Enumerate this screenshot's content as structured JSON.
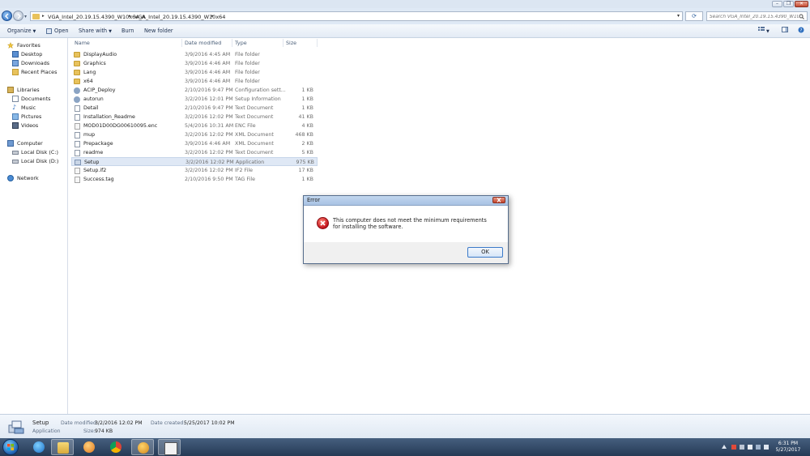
{
  "address": {
    "crumbs": [
      "VGA_Intel_20.19.15.4390_W10x64_A",
      "VGA_Intel_20.19.15.4390_W10x64"
    ],
    "search_placeholder": "Search VGA_Intel_20.19.15.4390_W10x64"
  },
  "toolbar": {
    "organize": "Organize",
    "open": "Open",
    "share_with": "Share with",
    "burn": "Burn",
    "new_folder": "New folder"
  },
  "nav": {
    "favorites": "Favorites",
    "desktop": "Desktop",
    "downloads": "Downloads",
    "recent_places": "Recent Places",
    "libraries": "Libraries",
    "documents": "Documents",
    "music": "Music",
    "pictures": "Pictures",
    "videos": "Videos",
    "computer": "Computer",
    "local_disk_c": "Local Disk (C:)",
    "local_disk_d": "Local Disk (D:)",
    "network": "Network"
  },
  "columns": {
    "name": "Name",
    "date_modified": "Date modified",
    "type": "Type",
    "size": "Size"
  },
  "files": [
    {
      "name": "DisplayAudio",
      "date": "3/9/2016 4:45 AM",
      "type": "File folder",
      "size": "",
      "icon": "folder"
    },
    {
      "name": "Graphics",
      "date": "3/9/2016 4:46 AM",
      "type": "File folder",
      "size": "",
      "icon": "folder"
    },
    {
      "name": "Lang",
      "date": "3/9/2016 4:46 AM",
      "type": "File folder",
      "size": "",
      "icon": "folder"
    },
    {
      "name": "x64",
      "date": "3/9/2016 4:46 AM",
      "type": "File folder",
      "size": "",
      "icon": "folder"
    },
    {
      "name": "ACIP_Deploy",
      "date": "2/10/2016 9:47 PM",
      "type": "Configuration sett...",
      "size": "1 KB",
      "icon": "gear"
    },
    {
      "name": "autorun",
      "date": "3/2/2016 12:01 PM",
      "type": "Setup Information",
      "size": "1 KB",
      "icon": "gear"
    },
    {
      "name": "Detail",
      "date": "2/10/2016 9:47 PM",
      "type": "Text Document",
      "size": "1 KB",
      "icon": "doc"
    },
    {
      "name": "Installation_Readme",
      "date": "3/2/2016 12:02 PM",
      "type": "Text Document",
      "size": "41 KB",
      "icon": "doc"
    },
    {
      "name": "MOD01D00DG00610095.enc",
      "date": "5/4/2016 10:31 AM",
      "type": "ENC File",
      "size": "4 KB",
      "icon": "blank"
    },
    {
      "name": "mup",
      "date": "3/2/2016 12:02 PM",
      "type": "XML Document",
      "size": "468 KB",
      "icon": "doc"
    },
    {
      "name": "Prepackage",
      "date": "3/9/2016 4:46 AM",
      "type": "XML Document",
      "size": "2 KB",
      "icon": "doc"
    },
    {
      "name": "readme",
      "date": "3/2/2016 12:02 PM",
      "type": "Text Document",
      "size": "5 KB",
      "icon": "doc"
    },
    {
      "name": "Setup",
      "date": "3/2/2016 12:02 PM",
      "type": "Application",
      "size": "975 KB",
      "icon": "app",
      "selected": true
    },
    {
      "name": "Setup.if2",
      "date": "3/2/2016 12:02 PM",
      "type": "IF2 File",
      "size": "17 KB",
      "icon": "blank"
    },
    {
      "name": "Success.tag",
      "date": "2/10/2016 9:50 PM",
      "type": "TAG File",
      "size": "1 KB",
      "icon": "blank"
    }
  ],
  "details": {
    "name": "Setup",
    "kind": "Application",
    "date_modified_label": "Date modified:",
    "date_modified": "3/2/2016 12:02 PM",
    "size_label": "Size:",
    "size": "974 KB",
    "date_created_label": "Date created:",
    "date_created": "5/25/2017 10:02 PM"
  },
  "dialog": {
    "title": "Error",
    "message": "This computer does not meet the minimum requirements for installing the software.",
    "ok": "OK"
  },
  "clock": {
    "time": "6:31 PM",
    "date": "5/27/2017"
  },
  "colors": {
    "accent": "#2b6bbd",
    "selection": "#dfe8f5",
    "error": "#c3121b",
    "taskbar": "#253a55"
  }
}
